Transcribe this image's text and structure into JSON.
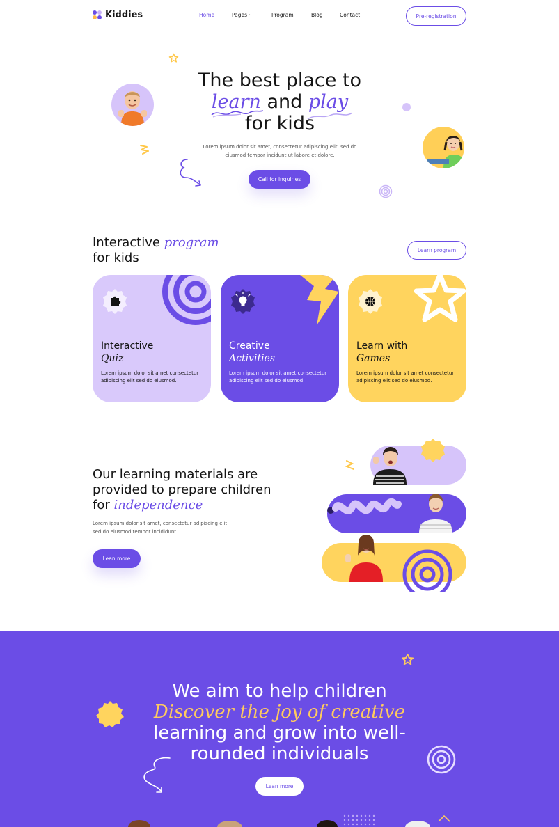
{
  "brand": {
    "name": "Kiddies"
  },
  "colors": {
    "primary": "#6b4de6",
    "lavender": "#d9c9fb",
    "yellow": "#ffd45e",
    "dark": "#141414"
  },
  "nav": {
    "items": [
      {
        "label": "Home",
        "active": true
      },
      {
        "label": "Pages",
        "has_dropdown": true
      },
      {
        "label": "Program"
      },
      {
        "label": "Blog"
      },
      {
        "label": "Contact"
      }
    ],
    "cta_label": "Pre-registration"
  },
  "hero": {
    "title_line1": "The best place to",
    "title_word_learn": "learn",
    "title_and": " and ",
    "title_word_play": "play",
    "title_line3": "for kids",
    "subtitle": "Lorem ipsum dolor sit amet, consectetur adipiscing elit, sed do eiusmod tempor incidunt ut labore et dolore.",
    "cta_label": "Call for inquiries"
  },
  "programs": {
    "title_prefix": "Interactive ",
    "title_highlight": "program",
    "title_line2": "for kids",
    "button_label": "Learn program",
    "cards": [
      {
        "title": "Interactive",
        "title_italic": "Quiz",
        "description": "Lorem ipsum dolor sit amet consectetur adipiscing elit sed do eiusmod.",
        "icon": "puzzle-icon"
      },
      {
        "title": "Creative",
        "title_italic": "Activities",
        "description": "Lorem ipsum dolor sit amet consectetur adipiscing elit sed do eiusmod.",
        "icon": "lightbulb-icon"
      },
      {
        "title": "Learn with",
        "title_italic": "Games",
        "description": "Lorem ipsum dolor sit amet consectetur adipiscing elit sed do eiusmod.",
        "icon": "basketball-icon"
      }
    ]
  },
  "materials": {
    "title_line1": "Our learning materials are",
    "title_line2": "provided to prepare children",
    "title_line3_prefix": "for ",
    "title_highlight": "independence",
    "subtitle": "Lorem ipsum dolor sit amet, consectetur adipiscing elit sed do eiusmod tempor incididunt.",
    "button_label": "Lean more"
  },
  "aim": {
    "line1": "We aim to help children",
    "line2": "Discover the joy of creative",
    "line3": "learning and grow into well-",
    "line4": "rounded individuals",
    "button_label": "Lean more"
  }
}
